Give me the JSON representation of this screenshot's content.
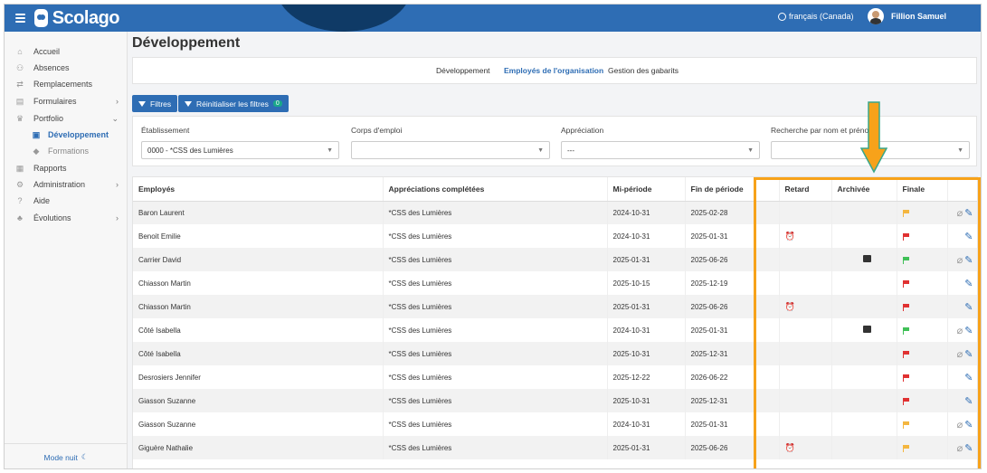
{
  "app": {
    "name": "Scolago"
  },
  "header": {
    "language": "français (Canada)",
    "user": "Fillion Samuel"
  },
  "sidebar": {
    "items": [
      {
        "label": "Accueil",
        "icon": "home-icon",
        "glyph": "⌂"
      },
      {
        "label": "Absences",
        "icon": "users-icon",
        "glyph": "⚇"
      },
      {
        "label": "Remplacements",
        "icon": "swap-icon",
        "glyph": "⇄"
      },
      {
        "label": "Formulaires",
        "icon": "form-icon",
        "glyph": "▤",
        "chevron": "›"
      },
      {
        "label": "Portfolio",
        "icon": "trophy-icon",
        "glyph": "♛",
        "chevron": "⌄"
      },
      {
        "label": "Développement",
        "icon": "id-card-icon",
        "glyph": "▣"
      },
      {
        "label": "Formations",
        "icon": "graduation-cap-icon",
        "glyph": "◆"
      },
      {
        "label": "Rapports",
        "icon": "report-icon",
        "glyph": "▦"
      },
      {
        "label": "Administration",
        "icon": "gear-icon",
        "glyph": "⚙",
        "chevron": "›"
      },
      {
        "label": "Aide",
        "icon": "help-icon",
        "glyph": "?"
      },
      {
        "label": "Évolutions",
        "icon": "sprout-icon",
        "glyph": "♣",
        "chevron": "›"
      }
    ],
    "footer": {
      "label": "Mode nuit",
      "icon_glyph": "☾"
    }
  },
  "page": {
    "title": "Développement"
  },
  "tabs": [
    "Développement",
    "Employés de l'organisation",
    "Gestion des gabarits"
  ],
  "buttons": {
    "filters": "Filtres",
    "reset": "Réinitialiser les filtres",
    "reset_count": "0"
  },
  "filters": {
    "etablissement": {
      "label": "Établissement",
      "value": "0000 - *CSS des Lumières"
    },
    "corps": {
      "label": "Corps d'emploi",
      "value": ""
    },
    "appreciation": {
      "label": "Appréciation",
      "value": "---"
    },
    "recherche": {
      "label": "Recherche par nom et prénom",
      "value": ""
    }
  },
  "table": {
    "columns": [
      "Employés",
      "Appréciations complétées",
      "Mi-période",
      "Fin de période",
      "Retard",
      "Archivée",
      "Finale"
    ],
    "rows": [
      {
        "name": "Baron Laurent",
        "org": "*CSS des Lumières",
        "mid": "2024-10-31",
        "end": "2025-02-28",
        "late": false,
        "archived": false,
        "final": "#f4b63f",
        "clip": true
      },
      {
        "name": "Benoit Emilie",
        "org": "*CSS des Lumières",
        "mid": "2024-10-31",
        "end": "2025-01-31",
        "late": true,
        "archived": false,
        "final": "#e03131",
        "clip": false
      },
      {
        "name": "Carrier David",
        "org": "*CSS des Lumières",
        "mid": "2025-01-31",
        "end": "2025-06-26",
        "late": false,
        "archived": true,
        "final": "#40c057",
        "clip": true
      },
      {
        "name": "Chiasson Martin",
        "org": "*CSS des Lumières",
        "mid": "2025-10-15",
        "end": "2025-12-19",
        "late": false,
        "archived": false,
        "final": "#e03131",
        "clip": false
      },
      {
        "name": "Chiasson Martin",
        "org": "*CSS des Lumières",
        "mid": "2025-01-31",
        "end": "2025-06-26",
        "late": true,
        "archived": false,
        "final": "#e03131",
        "clip": false
      },
      {
        "name": "Côté Isabella",
        "org": "*CSS des Lumières",
        "mid": "2024-10-31",
        "end": "2025-01-31",
        "late": false,
        "archived": true,
        "final": "#40c057",
        "clip": true
      },
      {
        "name": "Côté Isabella",
        "org": "*CSS des Lumières",
        "mid": "2025-10-31",
        "end": "2025-12-31",
        "late": false,
        "archived": false,
        "final": "#e03131",
        "clip": true
      },
      {
        "name": "Desrosiers Jennifer",
        "org": "*CSS des Lumières",
        "mid": "2025-12-22",
        "end": "2026-06-22",
        "late": false,
        "archived": false,
        "final": "#e03131",
        "clip": false
      },
      {
        "name": "Giasson Suzanne",
        "org": "*CSS des Lumières",
        "mid": "2025-10-31",
        "end": "2025-12-31",
        "late": false,
        "archived": false,
        "final": "#e03131",
        "clip": false
      },
      {
        "name": "Giasson Suzanne",
        "org": "*CSS des Lumières",
        "mid": "2024-10-31",
        "end": "2025-01-31",
        "late": false,
        "archived": false,
        "final": "#f4b63f",
        "clip": true
      },
      {
        "name": "Giguère Nathalie",
        "org": "*CSS des Lumières",
        "mid": "2025-01-31",
        "end": "2025-06-26",
        "late": true,
        "archived": false,
        "final": "#f4b63f",
        "clip": true
      }
    ]
  },
  "colors": {
    "brand": "#2e6db4",
    "highlight": "#f7a21a",
    "arrow": "#f7a21a",
    "arrow_outline": "#3aa68a"
  }
}
